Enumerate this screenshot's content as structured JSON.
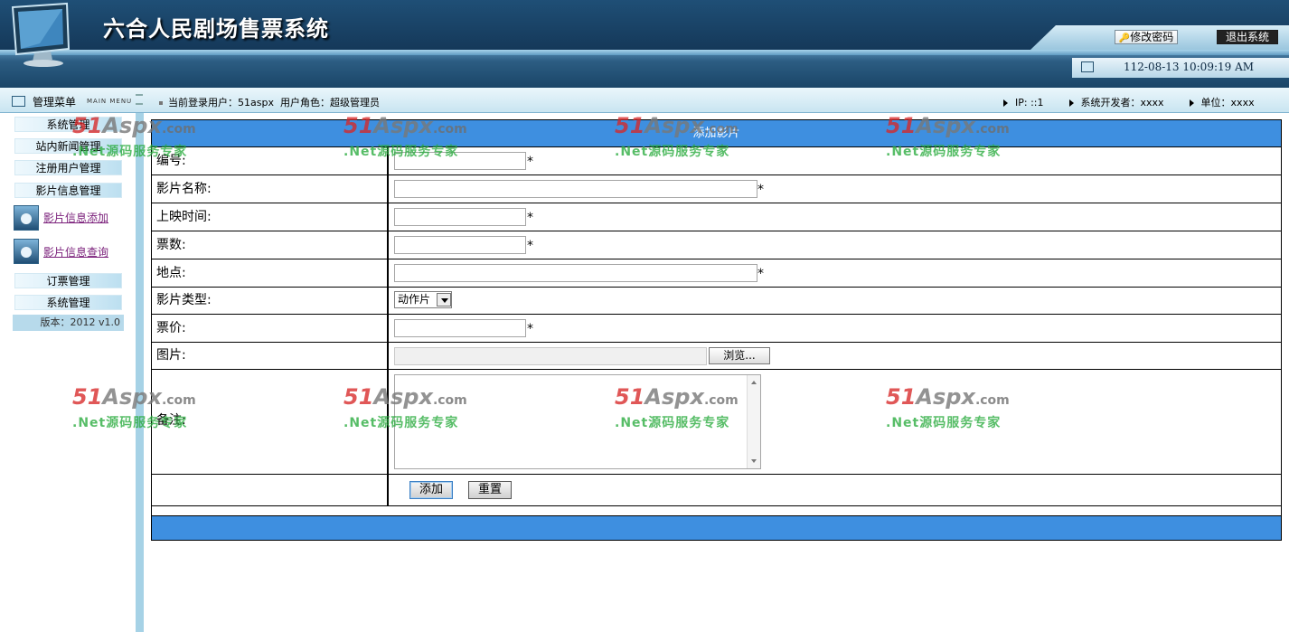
{
  "header": {
    "app_title": "六合人民剧场售票系统",
    "change_password": "修改密码",
    "exit_system": "退出系统",
    "datetime": "112-08-13 10:09:19 AM"
  },
  "infobar": {
    "menu_title": "管理菜单",
    "menu_en": "MAIN MENU",
    "current_user_label": "当前登录用户：51aspx",
    "role_label": "用户角色：超级管理员",
    "ip": "IP: ::1",
    "developer": "系统开发者：xxxx",
    "unit": "单位：xxxx"
  },
  "sidebar": {
    "items": [
      {
        "label": "系统管理"
      },
      {
        "label": "站内新闻管理"
      },
      {
        "label": "注册用户管理"
      },
      {
        "label": "影片信息管理"
      }
    ],
    "links": [
      {
        "label": "影片信息添加"
      },
      {
        "label": "影片信息查询"
      }
    ],
    "items2": [
      {
        "label": "订票管理"
      },
      {
        "label": "系统管理"
      }
    ],
    "version": "版本：2012 v1.0"
  },
  "form": {
    "title": "添加影片",
    "fields": {
      "id": {
        "label": "编号:",
        "value": ""
      },
      "name": {
        "label": "影片名称:",
        "value": ""
      },
      "show_time": {
        "label": "上映时间:",
        "value": ""
      },
      "tickets": {
        "label": "票数:",
        "value": ""
      },
      "location": {
        "label": "地点:",
        "value": ""
      },
      "type": {
        "label": "影片类型:",
        "value": "动作片"
      },
      "price": {
        "label": "票价:",
        "value": ""
      },
      "image": {
        "label": "图片:",
        "browse": "浏览..."
      },
      "remark": {
        "label": "备注:"
      }
    },
    "required_mark": "*",
    "add_button": "添加",
    "reset_button": "重置"
  },
  "watermark": {
    "brand_red": "51",
    "brand_grey": "Aspx",
    "brand_com": ".com",
    "slogan": ".Net源码服务专家"
  },
  "colors": {
    "header_bg": "#15395a",
    "form_title_bg": "#3e8fe0",
    "sidebar_sep": "#a6d2e6",
    "link_color": "#7a1f7a"
  }
}
